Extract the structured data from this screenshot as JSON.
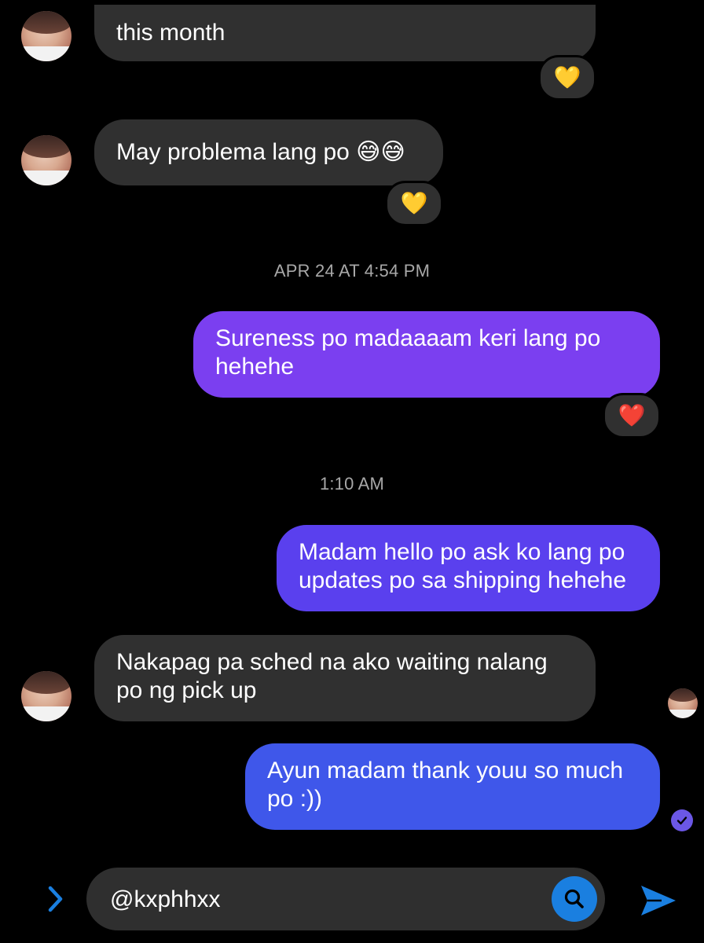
{
  "messages": [
    {
      "id": "m1",
      "direction": "incoming",
      "text": "this month",
      "reaction": "💛"
    },
    {
      "id": "m2",
      "direction": "incoming",
      "text": "May problema lang po 😅😅",
      "reaction": "💛"
    },
    {
      "id": "m3",
      "direction": "outgoing",
      "text": "Sureness po madaaaam keri lang po hehehe",
      "reaction": "❤️"
    },
    {
      "id": "m4",
      "direction": "outgoing",
      "text": "Madam hello po ask ko lang po updates po sa shipping hehehe"
    },
    {
      "id": "m5",
      "direction": "incoming",
      "text": "Nakapag pa sched na ako waiting nalang po ng pick up"
    },
    {
      "id": "m6",
      "direction": "outgoing",
      "text": "Ayun madam thank youu so much po :))"
    }
  ],
  "timestamps": [
    "APR 24 AT 4:54 PM",
    "1:10 AM"
  ],
  "composer": {
    "value": "@kxphhxx"
  },
  "icons": {
    "expand": "chevron-right-icon",
    "search": "search-icon",
    "send": "send-icon",
    "read_receipt": "check-circle-icon"
  },
  "colors": {
    "background": "#000000",
    "incoming_bubble": "#303030",
    "outgoing_bubble_top": "#7b3ff0",
    "outgoing_bubble_mid": "#5a40ee",
    "outgoing_bubble_bottom": "#3f57ea",
    "accent_blue": "#1a7fe0"
  }
}
